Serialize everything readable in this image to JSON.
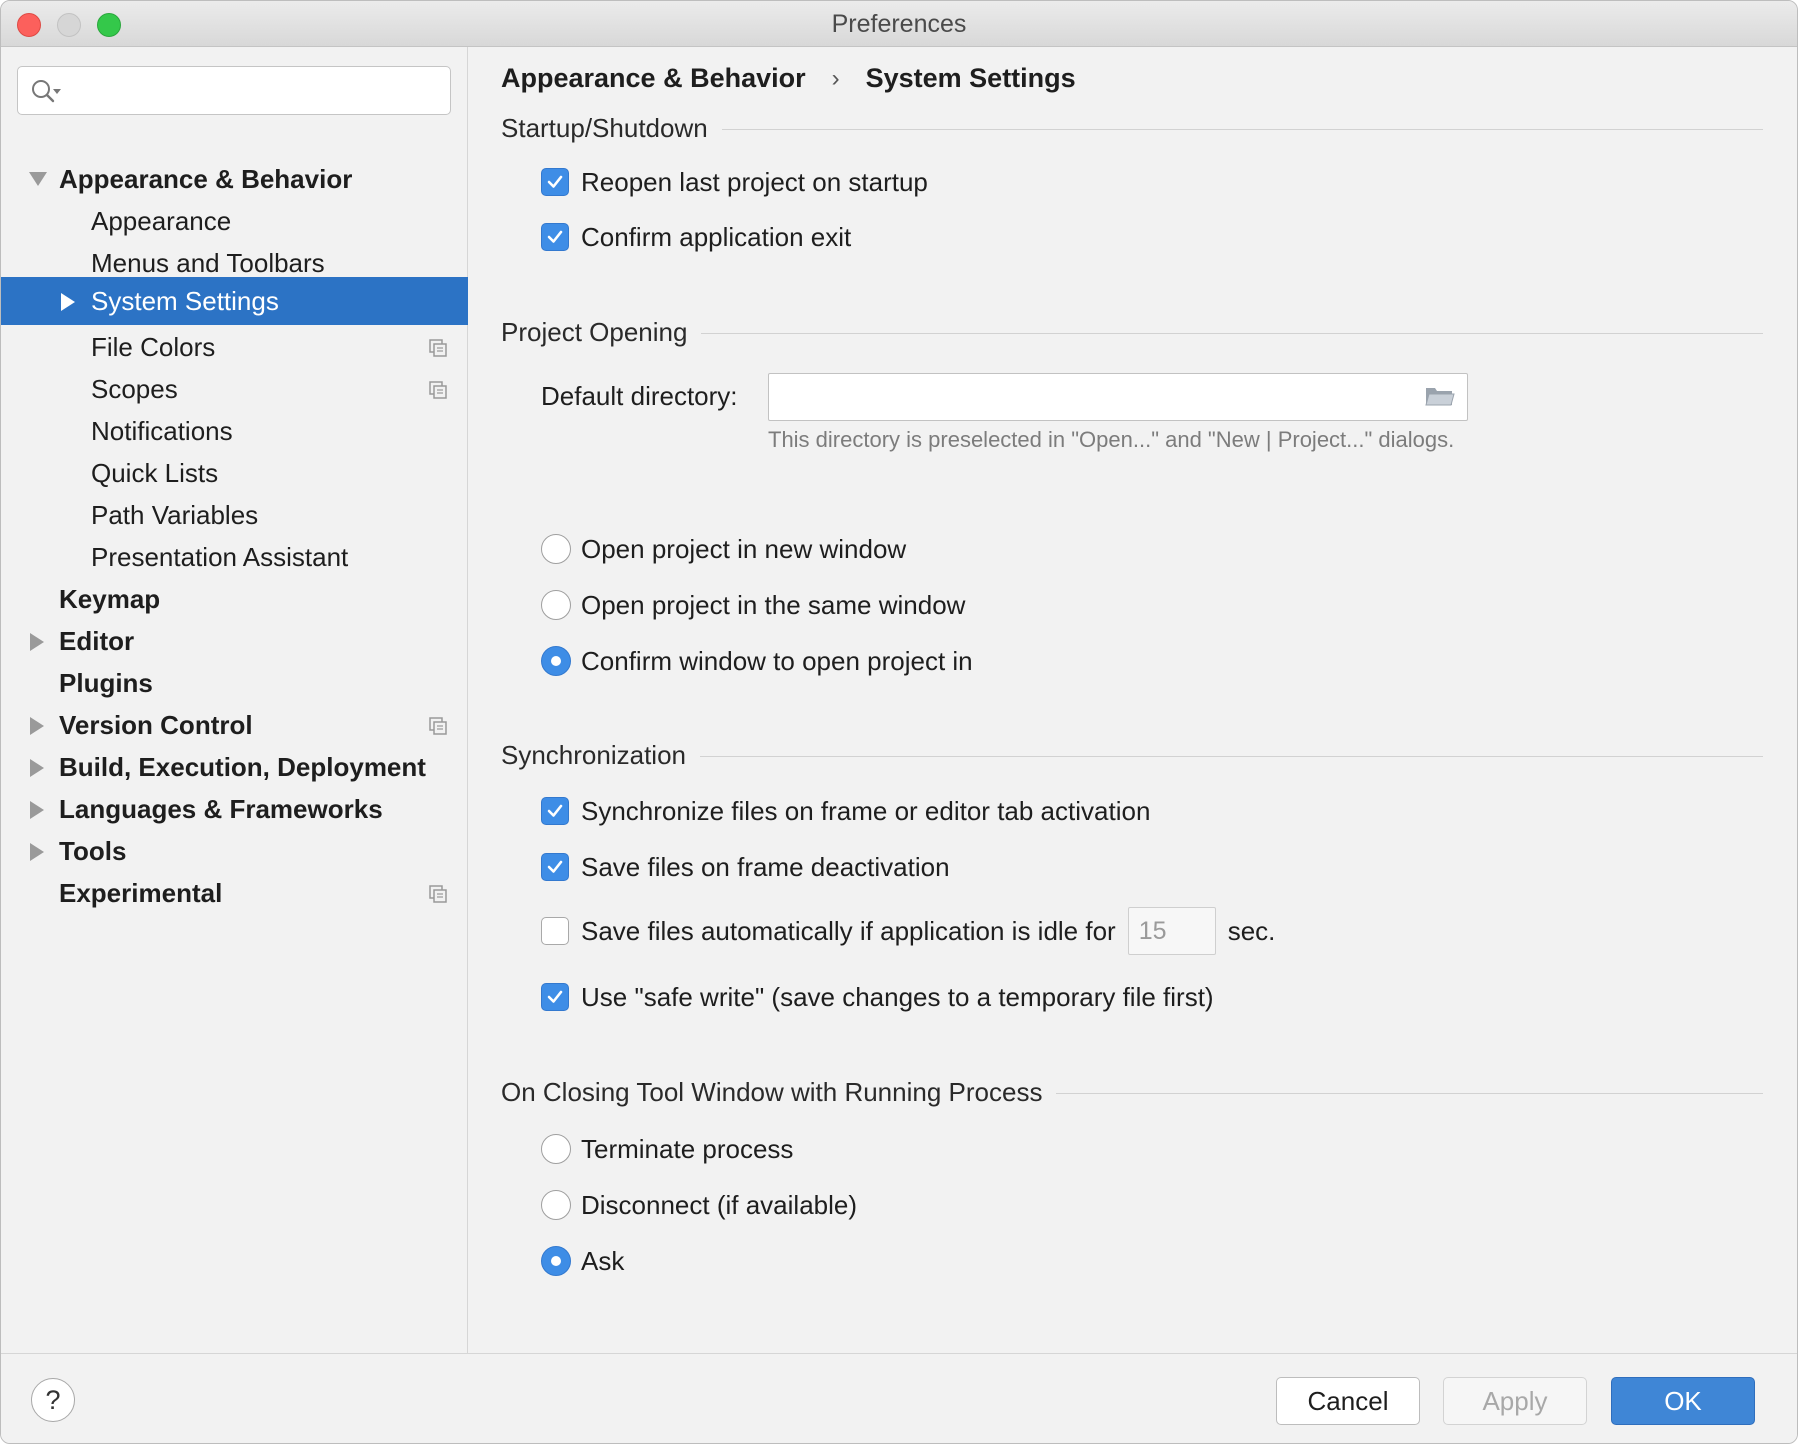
{
  "window": {
    "title": "Preferences"
  },
  "sidebar": {
    "search": {
      "placeholder": "",
      "icon": "search-icon"
    },
    "items": [
      {
        "label": "Appearance & Behavior",
        "level": 0,
        "bold": true,
        "arrow": "down"
      },
      {
        "label": "Appearance",
        "level": 1
      },
      {
        "label": "Menus and Toolbars",
        "level": 1
      },
      {
        "label": "System Settings",
        "level": 1,
        "selected": true,
        "arrow": "right"
      },
      {
        "label": "File Colors",
        "level": 1,
        "project_icon": true
      },
      {
        "label": "Scopes",
        "level": 1,
        "project_icon": true
      },
      {
        "label": "Notifications",
        "level": 1
      },
      {
        "label": "Quick Lists",
        "level": 1
      },
      {
        "label": "Path Variables",
        "level": 1
      },
      {
        "label": "Presentation Assistant",
        "level": 1
      },
      {
        "label": "Keymap",
        "level": 0,
        "bold": true
      },
      {
        "label": "Editor",
        "level": 0,
        "bold": true,
        "arrow": "right"
      },
      {
        "label": "Plugins",
        "level": 0,
        "bold": true
      },
      {
        "label": "Version Control",
        "level": 0,
        "bold": true,
        "arrow": "right",
        "project_icon": true
      },
      {
        "label": "Build, Execution, Deployment",
        "level": 0,
        "bold": true,
        "arrow": "right"
      },
      {
        "label": "Languages & Frameworks",
        "level": 0,
        "bold": true,
        "arrow": "right"
      },
      {
        "label": "Tools",
        "level": 0,
        "bold": true,
        "arrow": "right"
      },
      {
        "label": "Experimental",
        "level": 0,
        "bold": true,
        "project_icon": true
      }
    ]
  },
  "breadcrumb": {
    "parent": "Appearance & Behavior",
    "separator": "›",
    "current": "System Settings"
  },
  "startup": {
    "title": "Startup/Shutdown",
    "reopen_last": {
      "label": "Reopen last project on startup",
      "checked": true
    },
    "confirm_exit": {
      "label": "Confirm application exit",
      "checked": true
    }
  },
  "project_opening": {
    "title": "Project Opening",
    "default_dir_label": "Default directory:",
    "default_dir_value": "",
    "hint": "This directory is preselected in \"Open...\" and \"New | Project...\" dialogs.",
    "options": [
      {
        "label": "Open project in new window",
        "selected": false
      },
      {
        "label": "Open project in the same window",
        "selected": false
      },
      {
        "label": "Confirm window to open project in",
        "selected": true
      }
    ]
  },
  "synchronization": {
    "title": "Synchronization",
    "sync_files": {
      "label": "Synchronize files on frame or editor tab activation",
      "checked": true
    },
    "save_on_deactivation": {
      "label": "Save files on frame deactivation",
      "checked": true
    },
    "save_idle": {
      "label": "Save files automatically if application is idle for",
      "checked": false,
      "value": "15",
      "unit": "sec."
    },
    "safe_write": {
      "label": "Use \"safe write\" (save changes to a temporary file first)",
      "checked": true
    }
  },
  "closing": {
    "title": "On Closing Tool Window with Running Process",
    "options": [
      {
        "label": "Terminate process",
        "selected": false
      },
      {
        "label": "Disconnect (if available)",
        "selected": false
      },
      {
        "label": "Ask",
        "selected": true
      }
    ]
  },
  "footer": {
    "help": "?",
    "cancel": "Cancel",
    "apply": "Apply",
    "ok": "OK"
  },
  "colors": {
    "accent": "#2c73c5",
    "checkbox": "#3e8de6",
    "ok_button": "#3f86d6"
  }
}
